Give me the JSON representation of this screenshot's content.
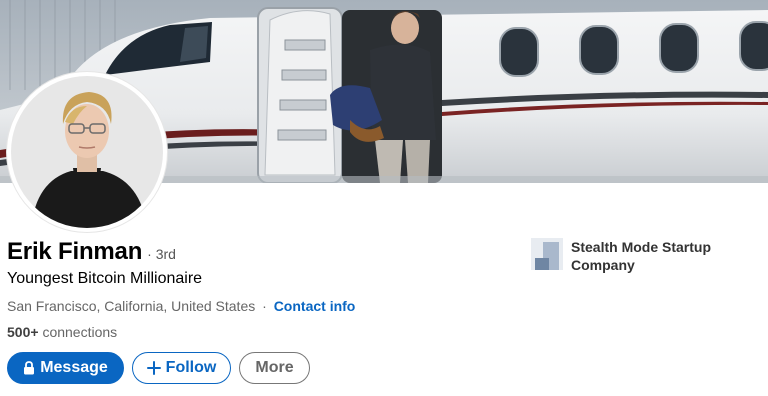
{
  "profile": {
    "name": "Erik Finman",
    "degree": "· 3rd",
    "headline": "Youngest Bitcoin Millionaire",
    "location": "San Francisco, California, United States",
    "location_separator": "·",
    "contact_label": "Contact info",
    "connections_count": "500+",
    "connections_label": "connections"
  },
  "actions": {
    "message_label": "Message",
    "follow_label": "Follow",
    "more_label": "More"
  },
  "company": {
    "name": "Stealth Mode Startup Company"
  },
  "colors": {
    "accent": "#0a66c2",
    "muted_text": "#666666"
  },
  "icons": {
    "message": "lock-icon",
    "follow": "plus-icon"
  }
}
